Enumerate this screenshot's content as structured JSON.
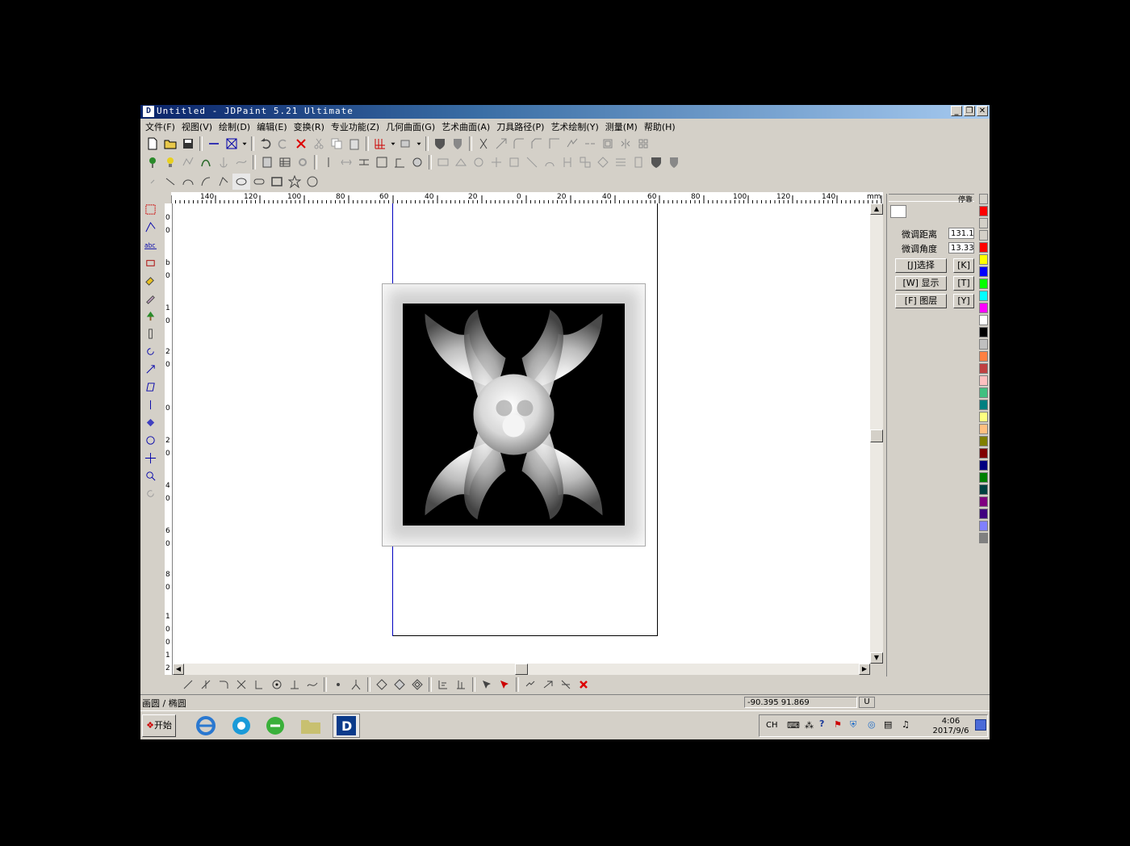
{
  "window": {
    "title": "Untitled - JDPaint 5.21 Ultimate",
    "app_icon": "D",
    "minimize": "_",
    "restore": "❐",
    "close": "✕"
  },
  "menu": [
    {
      "label": "文件(F)"
    },
    {
      "label": "视图(V)"
    },
    {
      "label": "绘制(D)"
    },
    {
      "label": "编辑(E)"
    },
    {
      "label": "变换(R)"
    },
    {
      "label": "专业功能(Z)"
    },
    {
      "label": "几何曲面(G)"
    },
    {
      "label": "艺术曲面(A)"
    },
    {
      "label": "刀具路径(P)"
    },
    {
      "label": "艺术绘制(Y)"
    },
    {
      "label": "测量(M)"
    },
    {
      "label": "帮助(H)"
    }
  ],
  "ruler": {
    "h_labels": [
      "140",
      "120",
      "100",
      "80",
      "60",
      "40",
      "20",
      "0",
      "20",
      "40",
      "60",
      "80",
      "100",
      "120",
      "140",
      "mm"
    ],
    "v_labels": [
      "0",
      "0",
      "b",
      "0",
      "1",
      "0",
      "2",
      "0",
      "0",
      "2",
      "0",
      "4",
      "0",
      "6",
      "0",
      "8",
      "0",
      "1",
      "0",
      "0",
      "1",
      "2"
    ]
  },
  "right_panel": {
    "header": "停靠",
    "field1_label": "微调距离",
    "field1_value": "131.1",
    "field2_label": "微调角度",
    "field2_value": "13.33",
    "buttons": [
      {
        "label": "[J]选择"
      },
      {
        "label": "[K]"
      },
      {
        "label": "[W] 显示"
      },
      {
        "label": "[T]"
      },
      {
        "label": "[F] 图层"
      },
      {
        "label": "[Y]"
      }
    ]
  },
  "palette": [
    "#d4d0c8",
    "#ff0000",
    "#d4d0c8",
    "#d4d0c8",
    "#ff0000",
    "#ffff00",
    "#0000ff",
    "#00ff00",
    "#00ffff",
    "#ff00ff",
    "#ffffff",
    "#000000",
    "#c0c0c0",
    "#ff8040",
    "#c04040",
    "#ffc0c0",
    "#40c080",
    "#008080",
    "#ffff80",
    "#ffc080",
    "#808000",
    "#800000",
    "#000080",
    "#008000",
    "#004040",
    "#800080",
    "#400080",
    "#8080ff",
    "#808080"
  ],
  "status": {
    "left": "画圆 / 椭圆",
    "coords": "-90.395  91.869",
    "snap_box": "U"
  },
  "taskbar": {
    "start": "开始",
    "tray_lang": "CH",
    "time": "4:06",
    "date": "2017/9/6"
  }
}
